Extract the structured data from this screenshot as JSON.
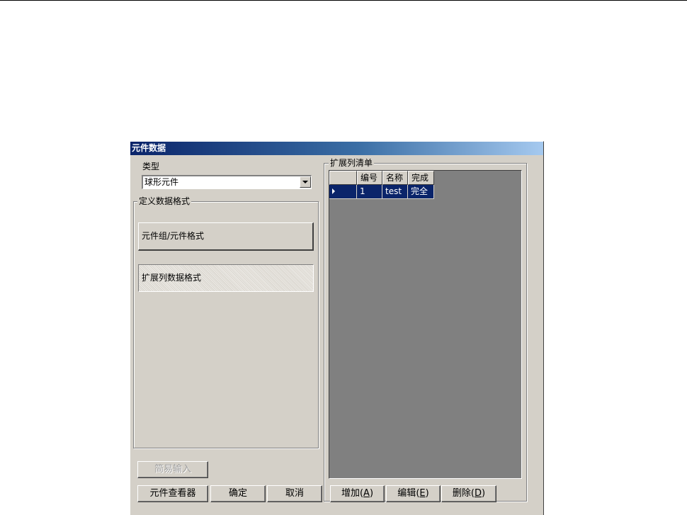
{
  "window": {
    "title": "元件数据"
  },
  "type_section": {
    "label": "类型",
    "selected": "球形元件"
  },
  "format_group": {
    "title": "定义数据格式",
    "buttons": [
      "元件组/元件格式",
      "扩展列数据格式"
    ]
  },
  "list_group": {
    "title": "扩展列清单",
    "columns": [
      "编号",
      "名称",
      "完成"
    ],
    "rows": [
      {
        "id": "1",
        "name": "test",
        "status": "完全"
      }
    ]
  },
  "buttons": {
    "simple_input": "简易输入",
    "viewer": "元件查看器",
    "ok": "确定",
    "cancel": "取消",
    "add": "增加",
    "add_key": "A",
    "edit": "编辑",
    "edit_key": "E",
    "delete": "删除",
    "delete_key": "D"
  },
  "colors": {
    "dialog_bg": "#d4d0c8",
    "title_start": "#0a246a",
    "title_end": "#a6caf0",
    "selection": "#0a246a",
    "grid_bg": "#808080"
  }
}
